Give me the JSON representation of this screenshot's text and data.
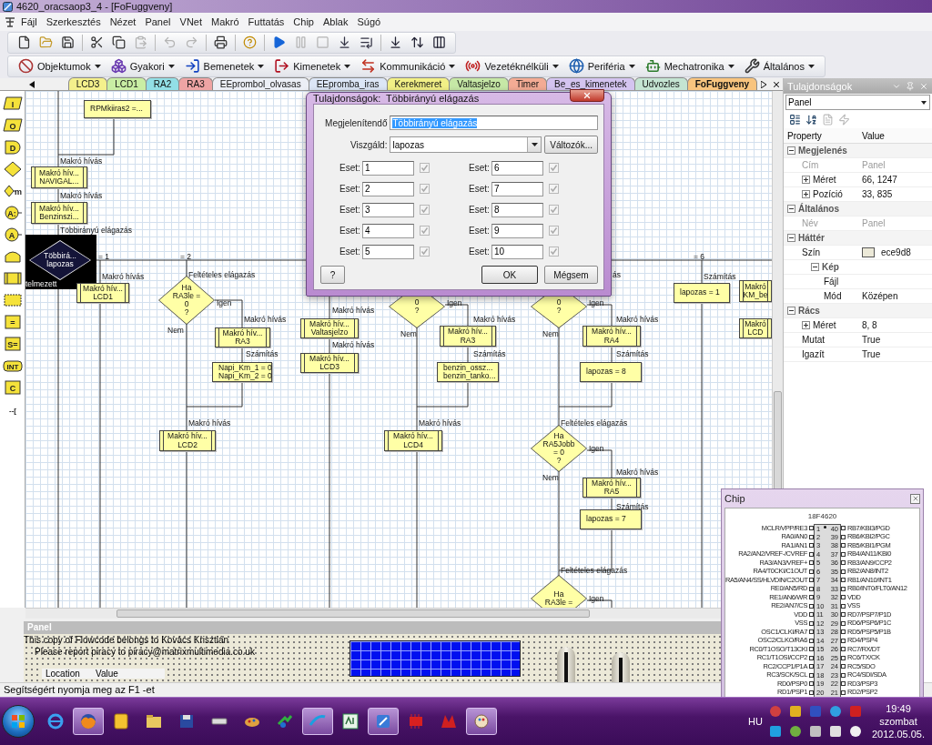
{
  "window": {
    "title": "4620_oracsaop3_4 - [FoFuggveny]"
  },
  "menu": [
    "Fájl",
    "Szerkesztés",
    "Nézet",
    "Panel",
    "VNet",
    "Makró",
    "Futtatás",
    "Chip",
    "Ablak",
    "Súgó"
  ],
  "toolbar": [
    {
      "kind": "new",
      "disabled": false
    },
    {
      "kind": "open",
      "disabled": false
    },
    {
      "kind": "save",
      "disabled": false
    },
    {
      "kind": "separator"
    },
    {
      "kind": "cut",
      "disabled": false
    },
    {
      "kind": "copy",
      "disabled": false
    },
    {
      "kind": "paste",
      "disabled": true
    },
    {
      "kind": "separator"
    },
    {
      "kind": "undo",
      "disabled": true
    },
    {
      "kind": "redo",
      "disabled": true
    },
    {
      "kind": "separator"
    },
    {
      "kind": "print",
      "disabled": false
    },
    {
      "kind": "separator"
    },
    {
      "kind": "help",
      "disabled": false
    },
    {
      "kind": "separator"
    },
    {
      "kind": "run",
      "disabled": false
    },
    {
      "kind": "pause",
      "disabled": true
    },
    {
      "kind": "stop",
      "disabled": true
    },
    {
      "kind": "step_into",
      "disabled": false
    },
    {
      "kind": "step_over",
      "disabled": false
    },
    {
      "kind": "separator"
    },
    {
      "kind": "code",
      "disabled": false
    },
    {
      "kind": "sort",
      "disabled": false
    },
    {
      "kind": "columns",
      "disabled": false
    }
  ],
  "components_toolbar": [
    {
      "kind": "objects",
      "label": "Objektumok"
    },
    {
      "kind": "common",
      "label": "Gyakori"
    },
    {
      "kind": "inputs",
      "label": "Bemenetek"
    },
    {
      "kind": "outputs",
      "label": "Kimenetek"
    },
    {
      "kind": "comms",
      "label": "Kommunikáció"
    },
    {
      "kind": "wireless",
      "label": "Vezetéknélküli"
    },
    {
      "kind": "peripheral",
      "label": "Periféria"
    },
    {
      "kind": "mechatronics",
      "label": "Mechatronika"
    },
    {
      "kind": "general",
      "label": "Általános"
    }
  ],
  "tabs": [
    {
      "label": "LCD3",
      "color": "#f4f08c",
      "selected": false
    },
    {
      "label": "LCD1",
      "color": "#c9eea4",
      "selected": false
    },
    {
      "label": "RA2",
      "color": "#92dfe6",
      "selected": false
    },
    {
      "label": "RA3",
      "color": "#eea4a4",
      "selected": false
    },
    {
      "label": "EEprombol_olvasas",
      "color": "#eceff6",
      "selected": false
    },
    {
      "label": "EEpromba_iras",
      "color": "#dce6f6",
      "selected": false
    },
    {
      "label": "Kerekmeret",
      "color": "#f2f086",
      "selected": false
    },
    {
      "label": "Valtasjelzo",
      "color": "#c6e8a6",
      "selected": false
    },
    {
      "label": "Timer",
      "color": "#f3ab94",
      "selected": false
    },
    {
      "label": "Be_es_kimenetek",
      "color": "#d4c4f0",
      "selected": false
    },
    {
      "label": "Udvozles",
      "color": "#c4e4d2",
      "selected": false
    },
    {
      "label": "FoFuggveny",
      "color": "#f8c47e",
      "selected": true
    }
  ],
  "palette": [
    {
      "kind": "input",
      "glyph": "I"
    },
    {
      "kind": "output",
      "glyph": "O"
    },
    {
      "kind": "delay",
      "glyph": "D"
    },
    {
      "kind": "decision"
    },
    {
      "kind": "switch",
      "glyph": "m"
    },
    {
      "kind": "component_macro",
      "glyph": "A:"
    },
    {
      "kind": "component",
      "glyph": "A"
    },
    {
      "kind": "loop"
    },
    {
      "kind": "macro"
    },
    {
      "kind": "embedded"
    },
    {
      "kind": "calculation",
      "glyph": "="
    },
    {
      "kind": "string",
      "glyph": "S="
    },
    {
      "kind": "interrupt",
      "glyph": "INT"
    },
    {
      "kind": "code",
      "glyph": "C"
    },
    {
      "kind": "comment",
      "glyph": "--["
    }
  ],
  "flowchart": {
    "nodes": [
      {
        "kind": "calc",
        "lines": [
          "RPMkiiras2 =..."
        ],
        "selected": false
      },
      {
        "kind": "macro",
        "lines": [
          "Makró hív...",
          "NAVIGAL..."
        ],
        "selected": false
      },
      {
        "kind": "macro",
        "lines": [
          "Makró hív...",
          "Benzinszi..."
        ],
        "selected": false
      },
      {
        "kind": "switch",
        "lines": [
          "Többirá...",
          "lapozas"
        ],
        "default_label": "telmezett",
        "selected": true
      },
      {
        "kind": "macro",
        "lines": [
          "Makró hív...",
          "LCD1"
        ],
        "selected": false
      },
      {
        "kind": "decision",
        "lines": [
          "Ha",
          "RA3le =",
          "0",
          "?"
        ],
        "selected": false
      },
      {
        "kind": "macro",
        "lines": [
          "Makró hív...",
          "RA3"
        ],
        "selected": false
      },
      {
        "kind": "calc",
        "lines": [
          "Napi_Km_1 = 0",
          "Napi_Km_2 = 0"
        ],
        "selected": false
      },
      {
        "kind": "macro",
        "lines": [
          "Makró hív...",
          "LCD2"
        ],
        "selected": false
      },
      {
        "kind": "macro",
        "lines": [
          "Makró hív...",
          "Valtasjelzo"
        ],
        "selected": false
      },
      {
        "kind": "macro",
        "lines": [
          "Makró hív...",
          "LCD3"
        ],
        "selected": false
      },
      {
        "kind": "decision",
        "lines": [
          "0",
          "?"
        ],
        "selected": false
      },
      {
        "kind": "macro",
        "lines": [
          "Makró hív...",
          "RA3"
        ],
        "selected": false
      },
      {
        "kind": "calc",
        "lines": [
          "benzin_ossz...",
          "benzin_tanko..."
        ],
        "selected": false
      },
      {
        "kind": "macro",
        "lines": [
          "Makró hív...",
          "LCD4"
        ],
        "selected": false
      },
      {
        "kind": "decision",
        "lines": [
          "0",
          "?"
        ],
        "selected": false
      },
      {
        "kind": "macro",
        "lines": [
          "Makró hív...",
          "RA4"
        ],
        "selected": false
      },
      {
        "kind": "calc",
        "lines": [
          "lapozas = 8"
        ],
        "selected": false
      },
      {
        "kind": "decision",
        "lines": [
          "Ha",
          "RA5Jobb",
          "= 0",
          "?"
        ],
        "selected": false
      },
      {
        "kind": "macro",
        "lines": [
          "Makró hív...",
          "RA5"
        ],
        "selected": false
      },
      {
        "kind": "calc",
        "lines": [
          "lapozas = 7"
        ],
        "selected": false
      },
      {
        "kind": "decision",
        "lines": [
          "Ha",
          "RA3le ="
        ],
        "selected": false
      },
      {
        "kind": "calc",
        "lines": [
          "lapozas = 1"
        ],
        "selected": false
      },
      {
        "kind": "macro",
        "lines": [
          "Makró",
          "KM_be"
        ],
        "selected": false
      },
      {
        "kind": "macro",
        "lines": [
          "Makró",
          "LCD"
        ],
        "selected": false
      }
    ],
    "captions": [
      "Makró hívás",
      "Makró hívás",
      "Többirányú elágazás",
      "= 1",
      "= 2",
      "= 6",
      "Makró hívás",
      "Feltételes elágazás",
      "Igen",
      "Nem",
      "Makró hívás",
      "Számítás",
      "Makró hívás",
      "Makró hívás",
      "Makró hívás",
      "Igen",
      "Nem",
      "Makró hívás",
      "Számítás",
      "Makró hívás",
      "ás",
      "Igen",
      "Nem",
      "Makró hívás",
      "Számítás",
      "Feltételes elágazás",
      "Igen",
      "Nem",
      "Makró hívás",
      "Számítás",
      "Feltételes elágazás",
      "Igen",
      "Számítás"
    ]
  },
  "dialog": {
    "title": "Tulajdonságok:  Többirányú elágazás",
    "display_label": "Megjelenítendő",
    "display_value": "Többirányú elágazás",
    "display_value_selected": true,
    "variable_label": "Viszgáld:",
    "variable_value": "lapozas",
    "variables_button": "Változók...",
    "cases": [
      {
        "label": "Eset:",
        "value": "1",
        "checked": true,
        "disabled": true
      },
      {
        "label": "Eset:",
        "value": "2",
        "checked": true,
        "disabled": true
      },
      {
        "label": "Eset:",
        "value": "3",
        "checked": true,
        "disabled": true
      },
      {
        "label": "Eset:",
        "value": "4",
        "checked": true,
        "disabled": true
      },
      {
        "label": "Eset:",
        "value": "5",
        "checked": true,
        "disabled": true
      },
      {
        "label": "Eset:",
        "value": "6",
        "checked": true,
        "disabled": true
      },
      {
        "label": "Eset:",
        "value": "7",
        "checked": true,
        "disabled": true
      },
      {
        "label": "Eset:",
        "value": "8",
        "checked": true,
        "disabled": true
      },
      {
        "label": "Eset:",
        "value": "9",
        "checked": true,
        "disabled": true
      },
      {
        "label": "Eset:",
        "value": "10",
        "checked": true,
        "disabled": true
      }
    ],
    "buttons": [
      {
        "kind": "help",
        "label": "?"
      },
      {
        "kind": "ok",
        "label": "OK"
      },
      {
        "kind": "cancel",
        "label": "Mégsem"
      }
    ]
  },
  "properties": {
    "title": "Tulajdonságok",
    "object": "Panel",
    "columns": [
      "Property",
      "Value"
    ],
    "groups": [
      {
        "name": "Megjelenés",
        "expanded": true,
        "children": [
          {
            "name": "Cím",
            "value": "Panel",
            "disabled": true
          },
          {
            "name": "Méret",
            "value": "66, 1247",
            "expanded": false,
            "disabled": false
          },
          {
            "name": "Pozíció",
            "value": "33, 835",
            "expanded": false,
            "disabled": false
          }
        ]
      },
      {
        "name": "Általános",
        "expanded": true,
        "children": [
          {
            "name": "Név",
            "value": "Panel",
            "disabled": true
          }
        ]
      },
      {
        "name": "Háttér",
        "expanded": true,
        "children": [
          {
            "name": "Szín",
            "value": "ece9d8",
            "color": "#ece9d8",
            "disabled": false
          },
          {
            "name": "Kép",
            "expanded": true,
            "children": [
              {
                "name": "Fájl",
                "disabled": false
              },
              {
                "name": "Mód",
                "value": "Középen",
                "disabled": false
              }
            ]
          }
        ]
      },
      {
        "name": "Rács",
        "expanded": true,
        "children": [
          {
            "name": "Méret",
            "value": "8, 8",
            "expanded": false,
            "disabled": false
          },
          {
            "name": "Mutat",
            "value": "True",
            "disabled": false
          },
          {
            "name": "Igazít",
            "value": "True",
            "disabled": false
          }
        ]
      }
    ]
  },
  "panel": {
    "title": "Panel",
    "lines": [
      "This copy of Flowcode belongs to Kovács Krisztián",
      "Please report piracy to piracy@matrixmultimedia.co.uk"
    ],
    "table_columns": [
      "Location",
      "Value"
    ]
  },
  "status_bar": "Segítségért nyomja meg az F1 -et",
  "chip": {
    "title": "Chip",
    "part": "18F4620",
    "left_pins": [
      {
        "number": "1",
        "name": "MCLR/VPP/RE3"
      },
      {
        "number": "2",
        "name": "RA0/AN0"
      },
      {
        "number": "3",
        "name": "RA1/AN1"
      },
      {
        "number": "4",
        "name": "RA2/AN2/VREF-/CVREF"
      },
      {
        "number": "5",
        "name": "RA3/AN3/VREF+"
      },
      {
        "number": "6",
        "name": "RA4/T0CKI/C1OUT"
      },
      {
        "number": "7",
        "name": "RA5/AN4/SS/HLVDIN/C2OUT"
      },
      {
        "number": "8",
        "name": "RE0/AN5/RD"
      },
      {
        "number": "9",
        "name": "RE1/AN6/WR"
      },
      {
        "number": "10",
        "name": "RE2/AN7/CS"
      },
      {
        "number": "11",
        "name": "VDD"
      },
      {
        "number": "12",
        "name": "VSS"
      },
      {
        "number": "13",
        "name": "OSC1/CLKI/RA7"
      },
      {
        "number": "14",
        "name": "OSC2/CLKO/RA6"
      },
      {
        "number": "15",
        "name": "RC0/T1OSO/T13CKI"
      },
      {
        "number": "16",
        "name": "RC1/T1OSI/CCP2"
      },
      {
        "number": "17",
        "name": "RC2/CCP1/P1A"
      },
      {
        "number": "18",
        "name": "RC3/SCK/SCL"
      },
      {
        "number": "19",
        "name": "RD0/PSP0"
      },
      {
        "number": "20",
        "name": "RD1/PSP1"
      }
    ],
    "right_pins": [
      {
        "number": "40",
        "name": "RB7/KBI3/PGD"
      },
      {
        "number": "39",
        "name": "RB6/KBI2/PGC"
      },
      {
        "number": "38",
        "name": "RB5/KBI1/PGM"
      },
      {
        "number": "37",
        "name": "RB4/AN11/KBI0"
      },
      {
        "number": "36",
        "name": "RB3/AN9/CCP2"
      },
      {
        "number": "35",
        "name": "RB2/AN8/INT2"
      },
      {
        "number": "34",
        "name": "RB1/AN10/INT1"
      },
      {
        "number": "33",
        "name": "RB0/INT0/FLT0/AN12"
      },
      {
        "number": "32",
        "name": "VDD"
      },
      {
        "number": "31",
        "name": "VSS"
      },
      {
        "number": "30",
        "name": "RD7/PSP7/P1D"
      },
      {
        "number": "29",
        "name": "RD6/PSP6/P1C"
      },
      {
        "number": "28",
        "name": "RD5/PSP5/P1B"
      },
      {
        "number": "27",
        "name": "RD4/PSP4"
      },
      {
        "number": "26",
        "name": "RC7/RX/DT"
      },
      {
        "number": "25",
        "name": "RC6/TX/CK"
      },
      {
        "number": "24",
        "name": "RC5/SDO"
      },
      {
        "number": "23",
        "name": "RC4/SDI/SDA"
      },
      {
        "number": "22",
        "name": "RD3/PSP3"
      },
      {
        "number": "21",
        "name": "RD2/PSP2"
      }
    ]
  },
  "taskbar": {
    "apps": [
      {
        "kind": "ie",
        "active": false
      },
      {
        "kind": "firefox",
        "active": true
      },
      {
        "kind": "notes",
        "active": false
      },
      {
        "kind": "folder",
        "active": false
      },
      {
        "kind": "floppy",
        "active": false
      },
      {
        "kind": "drive",
        "active": false
      },
      {
        "kind": "paint",
        "active": false
      },
      {
        "kind": "arrows",
        "active": false
      },
      {
        "kind": "telenor",
        "active": true
      },
      {
        "kind": "ab",
        "active": false
      },
      {
        "kind": "flowcode",
        "active": true
      },
      {
        "kind": "chip",
        "active": false
      },
      {
        "kind": "mlogo",
        "active": false
      },
      {
        "kind": "palette",
        "active": true
      }
    ],
    "language": "HU",
    "time": "19:49",
    "day": "szombat",
    "date": "2012.05.05."
  }
}
